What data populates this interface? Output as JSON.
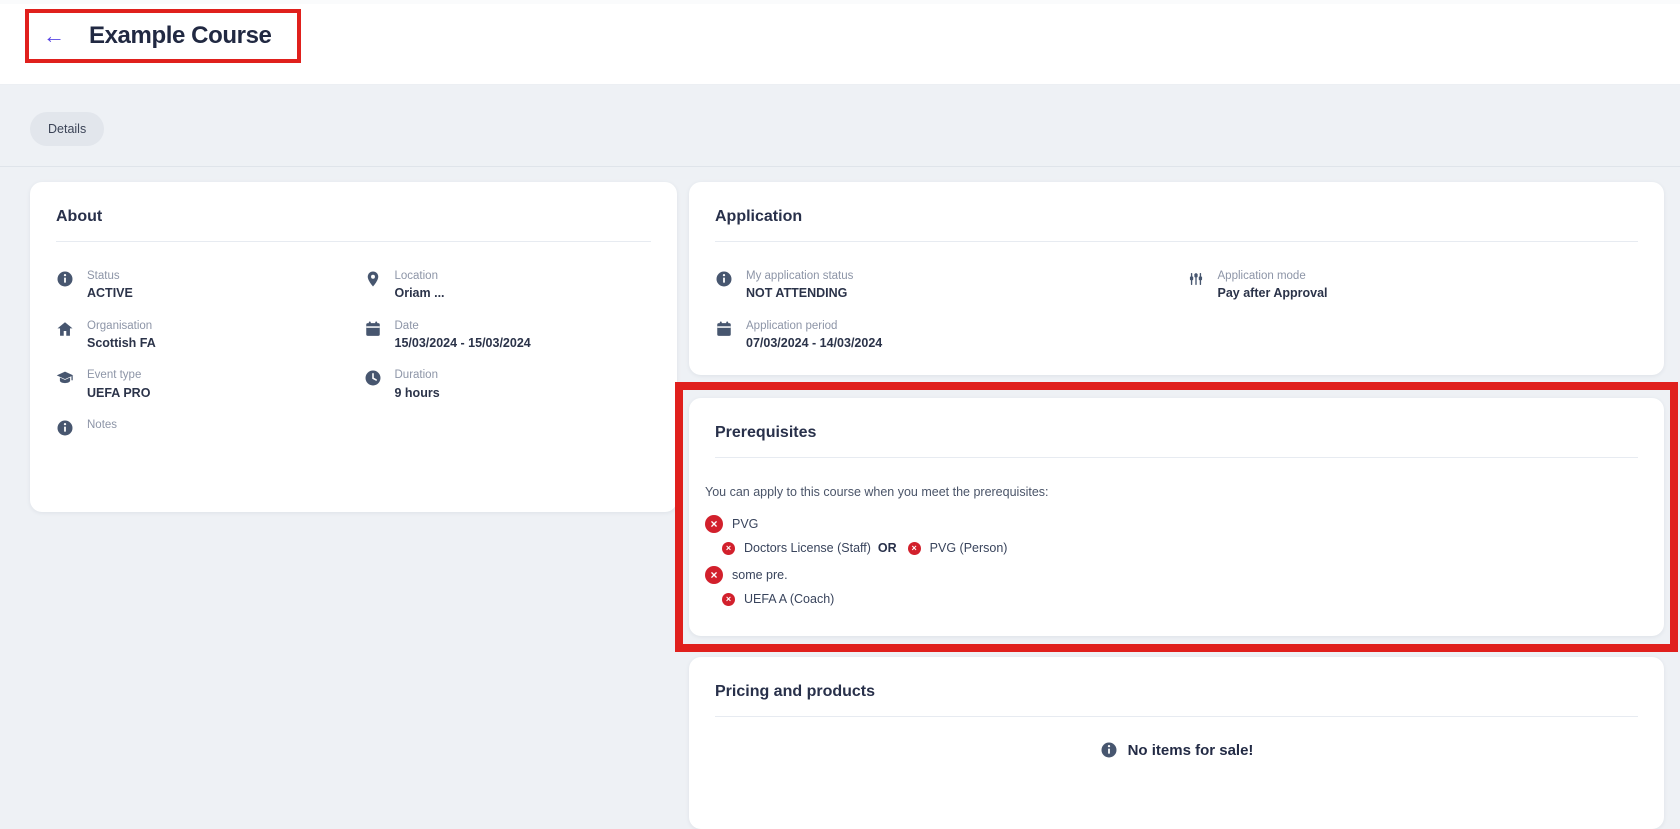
{
  "colors": {
    "annotation_red": "#e0201d",
    "danger_red": "#d2202c",
    "icon_slate": "#47566f",
    "accent_purple": "#5946e4",
    "page_bg": "#eef1f5"
  },
  "header": {
    "back_icon": "arrow-left",
    "title": "Example Course"
  },
  "tabs": [
    {
      "label": "Details"
    }
  ],
  "about": {
    "title": "About",
    "col1": [
      {
        "icon": "info-icon",
        "label": "Status",
        "value": "ACTIVE"
      },
      {
        "icon": "home-icon",
        "label": "Organisation",
        "value": "Scottish FA"
      },
      {
        "icon": "graduation-cap-icon",
        "label": "Event type",
        "value": "UEFA PRO"
      },
      {
        "icon": "info-icon",
        "label": "Notes",
        "value": ""
      }
    ],
    "col2": [
      {
        "icon": "map-pin-icon",
        "label": "Location",
        "value": "Oriam ..."
      },
      {
        "icon": "calendar-icon",
        "label": "Date",
        "value": "15/03/2024 - 15/03/2024"
      },
      {
        "icon": "clock-icon",
        "label": "Duration",
        "value": "9 hours"
      }
    ]
  },
  "application": {
    "title": "Application",
    "col1": [
      {
        "icon": "info-icon",
        "label": "My application status",
        "value": "NOT ATTENDING"
      },
      {
        "icon": "calendar-icon",
        "label": "Application period",
        "value": "07/03/2024 - 14/03/2024"
      }
    ],
    "col2": [
      {
        "icon": "sliders-icon",
        "label": "Application mode",
        "value": "Pay after Approval"
      }
    ]
  },
  "prerequisites": {
    "title": "Prerequisites",
    "intro": "You can apply to this course when you meet the prerequisites:",
    "groups": [
      {
        "label": "PVG",
        "status": "not-met",
        "operator": "OR",
        "items": [
          "Doctors License (Staff)",
          "PVG (Person)"
        ]
      },
      {
        "label": "some pre.",
        "status": "not-met",
        "items": [
          "UEFA A (Coach)"
        ]
      }
    ]
  },
  "pricing": {
    "title": "Pricing and products",
    "empty_message": "No items for sale!"
  }
}
